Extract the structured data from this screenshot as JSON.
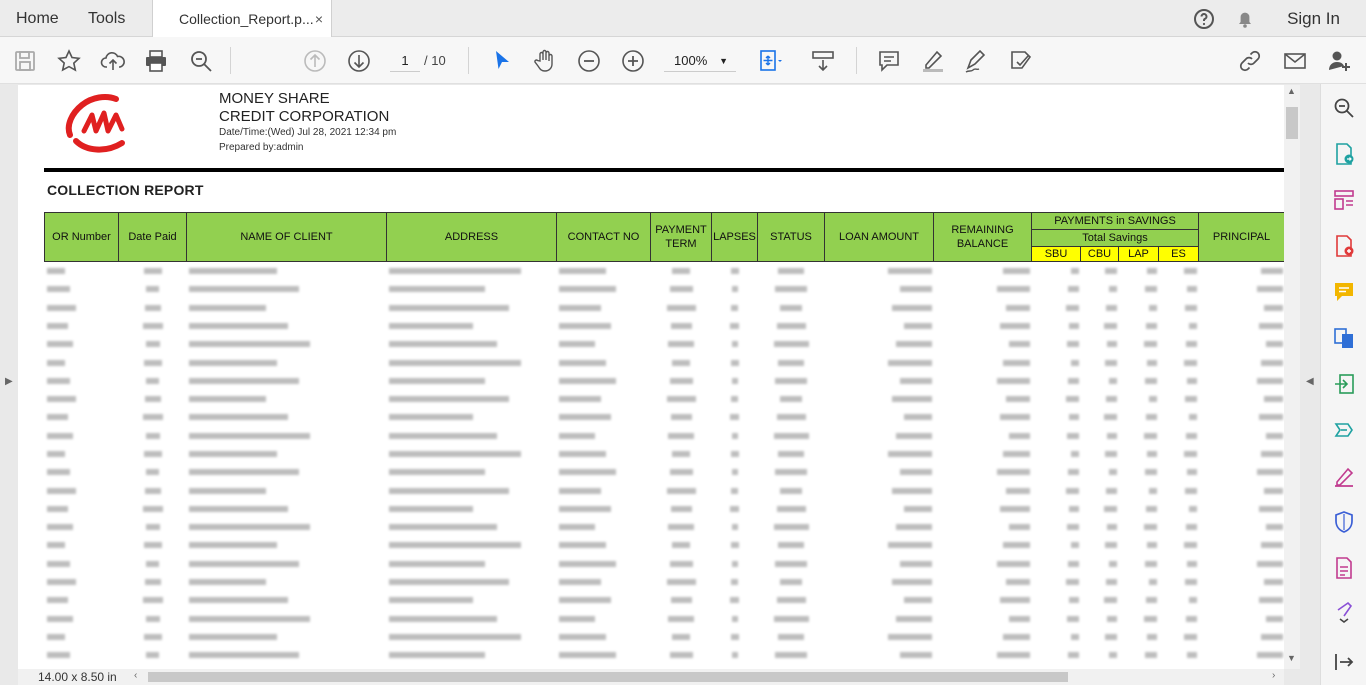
{
  "tabs": {
    "home": "Home",
    "tools": "Tools",
    "document": "Collection_Report.p...",
    "close": "×",
    "sign_in": "Sign In"
  },
  "toolbar": {
    "page_current": "1",
    "page_total": "/ 10",
    "zoom": "100%"
  },
  "icons": [
    "save-icon",
    "bookmark-star-icon",
    "upload-cloud-icon",
    "print-icon",
    "zoom-search-icon",
    "page-up-icon",
    "page-down-icon",
    "select-cursor-icon",
    "hand-tool-icon",
    "zoom-out-icon",
    "zoom-in-icon",
    "fit-page-icon",
    "scroll-mode-icon",
    "comment-icon",
    "highlight-pen-icon",
    "sign-icon",
    "fill-sign-icon",
    "share-link-icon",
    "email-icon",
    "add-user-icon",
    "help-icon",
    "bell-icon"
  ],
  "report": {
    "company_line1": "MONEY SHARE",
    "company_line2": "CREDIT CORPORATION",
    "datetime": "Date/Time:(Wed) Jul 28, 2021 12:34 pm",
    "prepared_by": "Prepared by:admin",
    "title": "COLLECTION REPORT",
    "headers": {
      "or_number": "OR Number",
      "date_paid": "Date Paid",
      "name": "NAME OF CLIENT",
      "address": "ADDRESS",
      "contact": "CONTACT NO",
      "payment_term": "PAYMENT TERM",
      "lapses": "LAPSES",
      "status": "STATUS",
      "loan_amount": "LOAN AMOUNT",
      "remaining_balance": "REMAINING BALANCE",
      "payments_savings": "PAYMENTS in SAVINGS",
      "total_savings": "Total Savings",
      "sbu": "SBU",
      "cbu": "CBU",
      "lap": "LAP",
      "es": "ES",
      "principal": "PRINCIPAL"
    }
  },
  "status_bar": {
    "page_size": "14.00 x 8.50 in"
  },
  "colors": {
    "header_green": "#92d050",
    "subheader_yellow": "#ffff00",
    "logo_red": "#e02020",
    "accent_blue": "#1a73e8"
  }
}
